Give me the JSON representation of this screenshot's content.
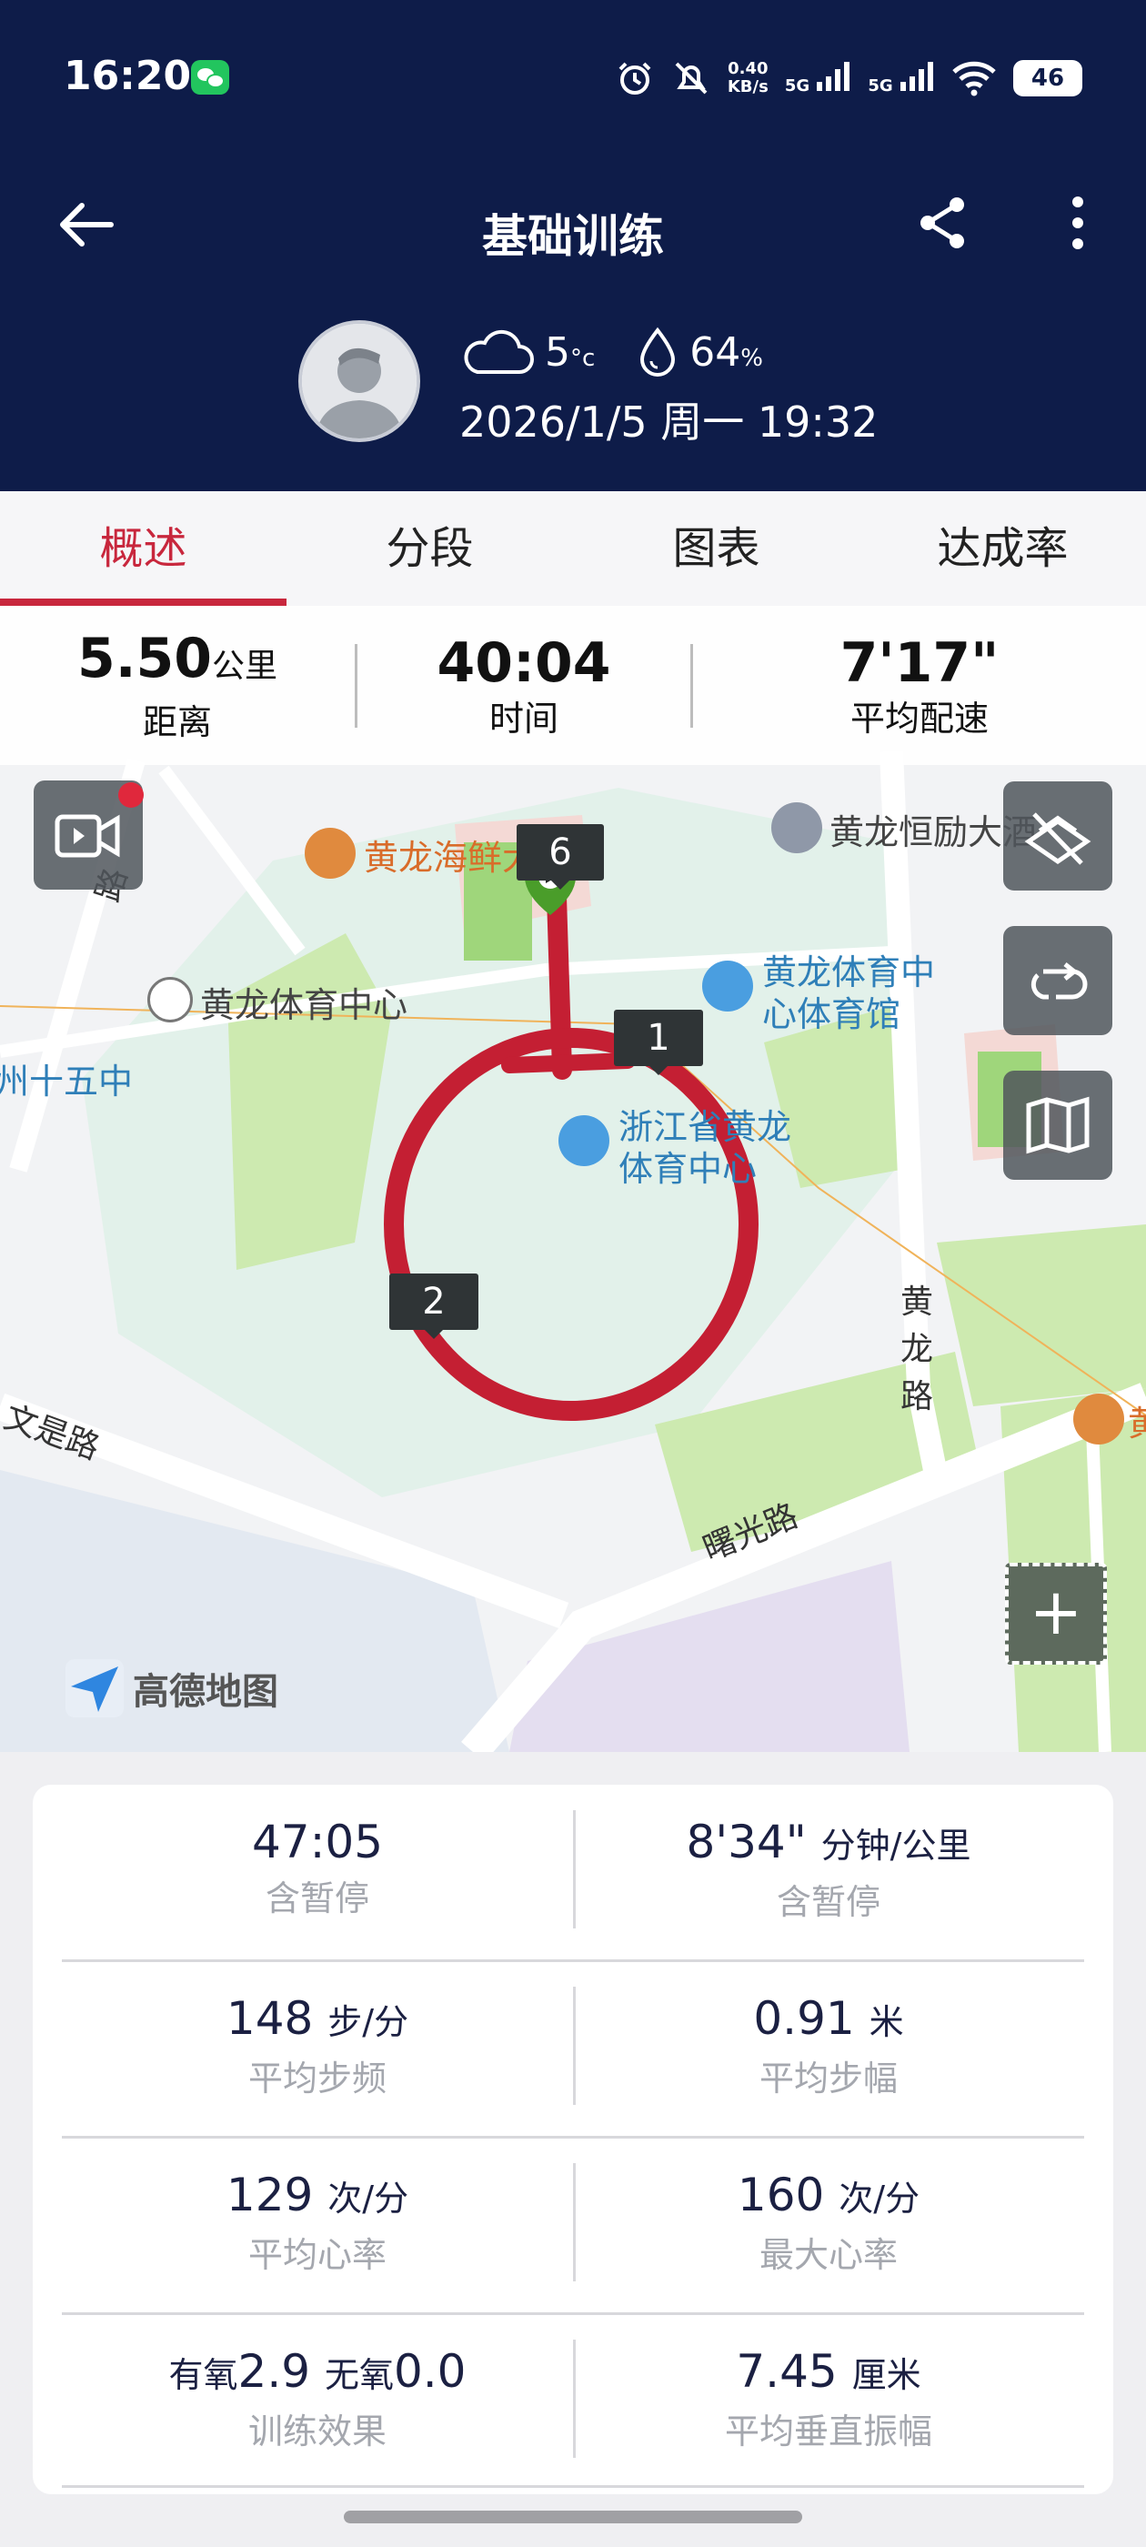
{
  "status_bar": {
    "time": "16:20",
    "net_speed_value": "0.40",
    "net_speed_unit": "KB/s",
    "sim1": "5G",
    "sim2": "5G",
    "battery": "46"
  },
  "header": {
    "title": "基础训练",
    "temperature": "5",
    "temperature_unit": "°c",
    "humidity": "64",
    "humidity_unit": "%",
    "datetime": "2026/1/5 周一 19:32"
  },
  "tabs": [
    {
      "label": "概述",
      "active": true
    },
    {
      "label": "分段",
      "active": false
    },
    {
      "label": "图表",
      "active": false
    },
    {
      "label": "达成率",
      "active": false
    }
  ],
  "stats_bar": {
    "distance_value": "5.50",
    "distance_unit": "公里",
    "distance_label": "距离",
    "time_value": "40:04",
    "time_label": "时间",
    "pace_value": "7'17\"",
    "pace_label": "平均配速"
  },
  "map": {
    "labels": {
      "restaurant": "黄龙海鲜大排档",
      "hotel": "黄龙恒励大酒",
      "sports_center": "黄龙体育中心",
      "gym": "黄龙体育中心体育馆",
      "gym_line1": "黄龙体育中",
      "gym_line2": "心体育馆",
      "stadium_line1": "浙江省黄龙",
      "stadium_line2": "体育中心",
      "district": "州十五中",
      "road_wenxing": "文是路",
      "road_huanglong": "黄龙路",
      "road_shuguang": "曙光路",
      "road_top": "路",
      "poi_right": "黄"
    },
    "markers": [
      "6",
      "1",
      "2"
    ],
    "logo": "高德地图",
    "zoom_label": "+"
  },
  "summary": [
    [
      {
        "value": "47:05",
        "unit": "",
        "label": "含暂停"
      },
      {
        "value": "8'34\"",
        "unit": "分钟/公里",
        "label": "含暂停"
      }
    ],
    [
      {
        "value": "148",
        "unit": "步/分",
        "label": "平均步频"
      },
      {
        "value": "0.91",
        "unit": "米",
        "label": "平均步幅"
      }
    ],
    [
      {
        "value": "129",
        "unit": "次/分",
        "label": "平均心率"
      },
      {
        "value": "160",
        "unit": "次/分",
        "label": "最大心率"
      }
    ],
    [
      {
        "value_prefix1": "有氧",
        "value1": "2.9",
        "value_prefix2": "无氧",
        "value2": "0.0",
        "label": "训练效果"
      },
      {
        "value": "7.45",
        "unit": "厘米",
        "label": "平均垂直振幅"
      }
    ]
  ],
  "colors": {
    "header_bg": "#0e1c49",
    "accent_red": "#c8273d",
    "route_red": "#c41f33"
  }
}
